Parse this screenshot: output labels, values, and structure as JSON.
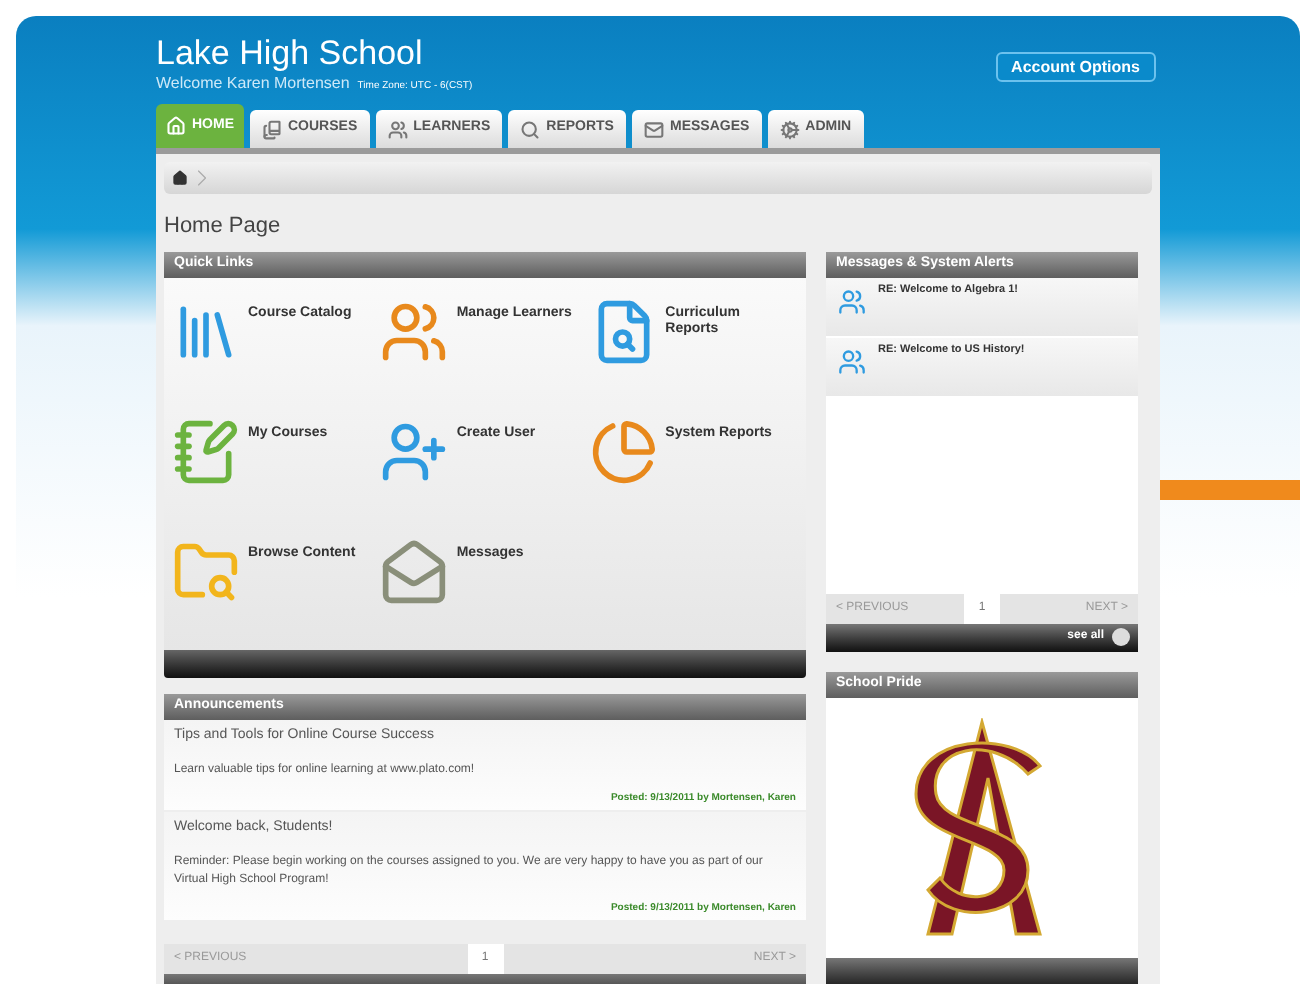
{
  "header": {
    "school": "Lake High School",
    "welcome": "Welcome Karen Mortensen",
    "timezone": "Time Zone: UTC - 6(CST)",
    "account_button": "Account Options"
  },
  "tabs": [
    {
      "label": "HOME",
      "selected": true
    },
    {
      "label": "COURSES",
      "selected": false
    },
    {
      "label": "LEARNERS",
      "selected": false
    },
    {
      "label": "REPORTS",
      "selected": false
    },
    {
      "label": "MESSAGES",
      "selected": false
    },
    {
      "label": "ADMIN",
      "selected": false
    }
  ],
  "page_title": "Home Page",
  "quick_links": {
    "title": "Quick Links",
    "items": [
      "Course Catalog",
      "Manage Learners",
      "Curriculum Reports",
      "My Courses",
      "Create User",
      "System Reports",
      "Browse Content",
      "Messages"
    ]
  },
  "alerts": {
    "title": "Messages & System Alerts",
    "items": [
      "RE: Welcome to Algebra 1!",
      "RE: Welcome to US History!"
    ],
    "pager": {
      "previous": "< PREVIOUS",
      "page": "1",
      "next": "NEXT >"
    },
    "see_all": "see all"
  },
  "announcements": {
    "title": "Announcements",
    "items": [
      {
        "title": "Tips and Tools for Online Course Success",
        "body": "Learn valuable tips for online learning at www.plato.com!",
        "posted": "Posted: 9/13/2011 by Mortensen, Karen"
      },
      {
        "title": "Welcome back, Students!",
        "body": "Reminder: Please begin working on the courses assigned to you. We are very happy to have you as part of our Virtual High School Program!",
        "posted": "Posted: 9/13/2011 by Mortensen, Karen"
      }
    ],
    "pager": {
      "previous": "< PREVIOUS",
      "page": "1",
      "next": "NEXT >"
    }
  },
  "school_pride": {
    "title": "School Pride"
  }
}
